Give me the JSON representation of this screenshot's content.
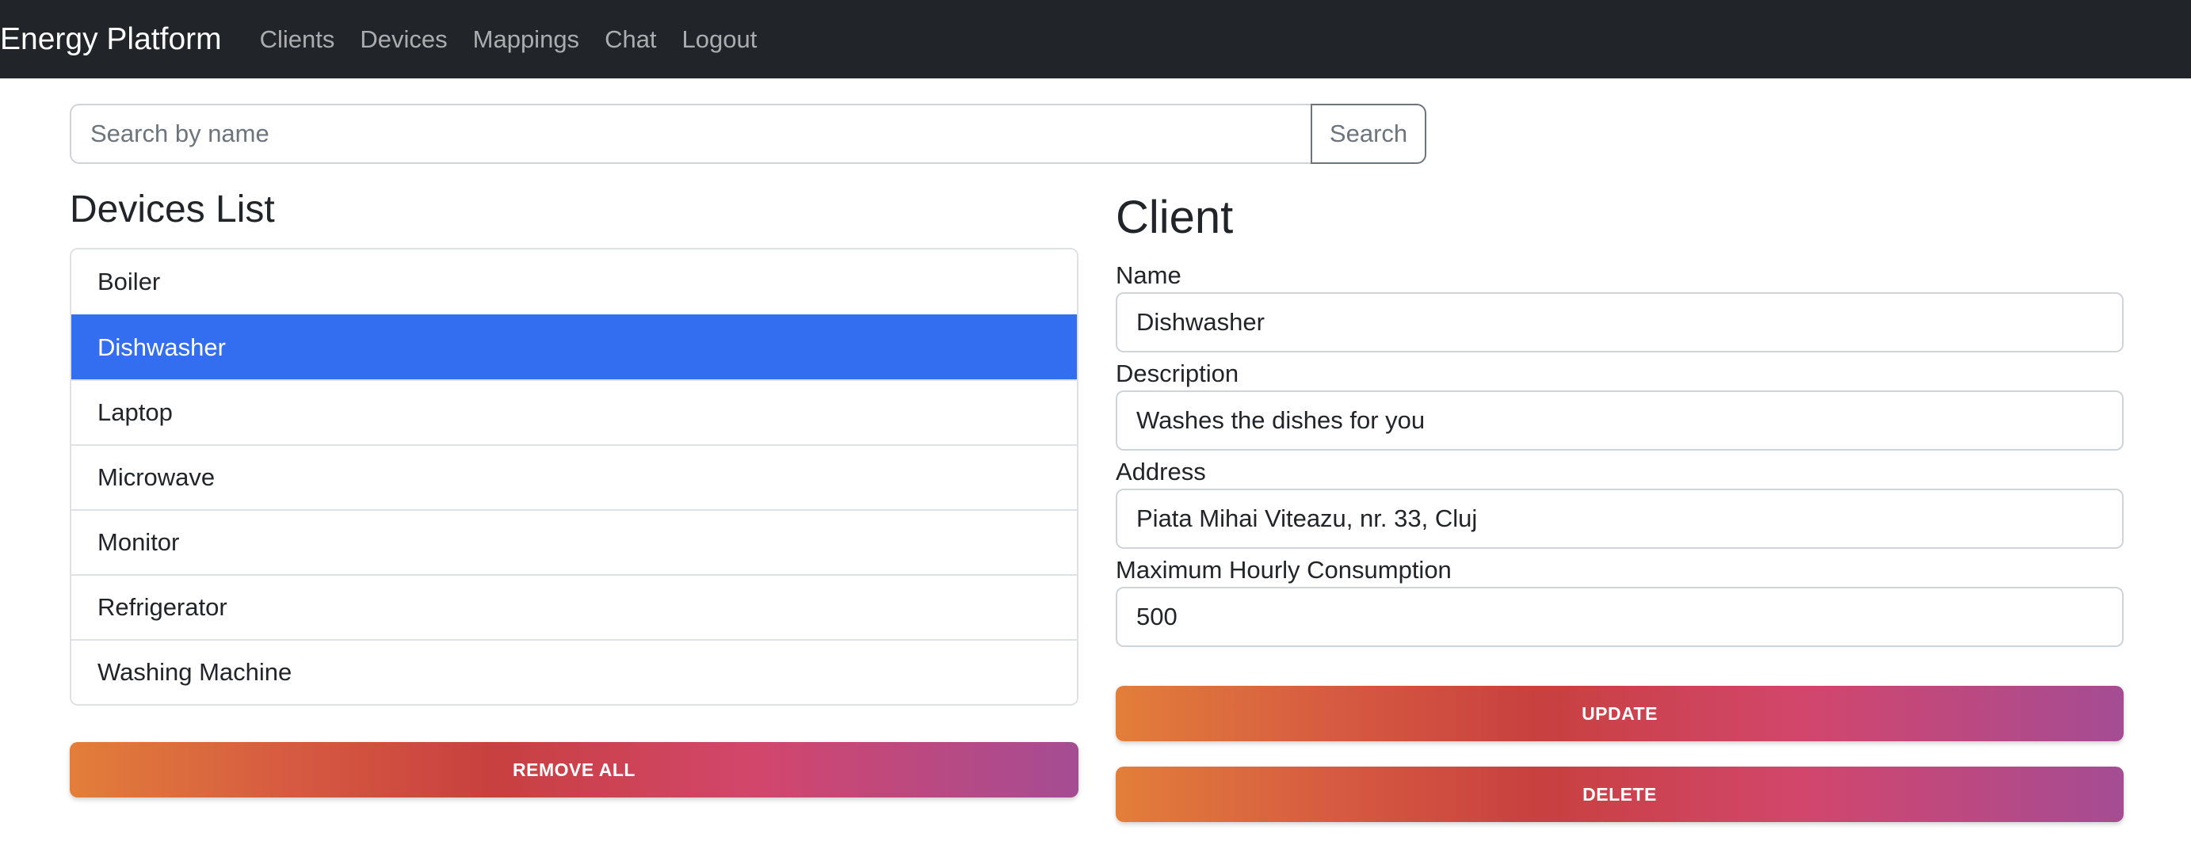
{
  "navbar": {
    "brand": "Energy Platform",
    "links": [
      "Clients",
      "Devices",
      "Mappings",
      "Chat",
      "Logout"
    ]
  },
  "search": {
    "placeholder": "Search by name",
    "value": "",
    "button_label": "Search"
  },
  "devices": {
    "title": "Devices List",
    "items": [
      "Boiler",
      "Dishwasher",
      "Laptop",
      "Microwave",
      "Monitor",
      "Refrigerator",
      "Washing Machine"
    ],
    "selected": "Dishwasher",
    "remove_all_label": "REMOVE ALL"
  },
  "client": {
    "title": "Client",
    "name_label": "Name",
    "name_value": "Dishwasher",
    "description_label": "Description",
    "description_value": "Washes the dishes for you",
    "address_label": "Address",
    "address_value": "Piata Mihai Viteazu, nr. 33, Cluj",
    "consumption_label": "Maximum Hourly Consumption",
    "consumption_value": "500",
    "update_label": "UPDATE",
    "delete_label": "DELETE"
  },
  "colors": {
    "navbar_bg": "#212529",
    "active_item": "#346ef0",
    "gradient_start": "#e27e3a",
    "gradient_mid": "#c8403f",
    "gradient_end": "#a54c94"
  }
}
